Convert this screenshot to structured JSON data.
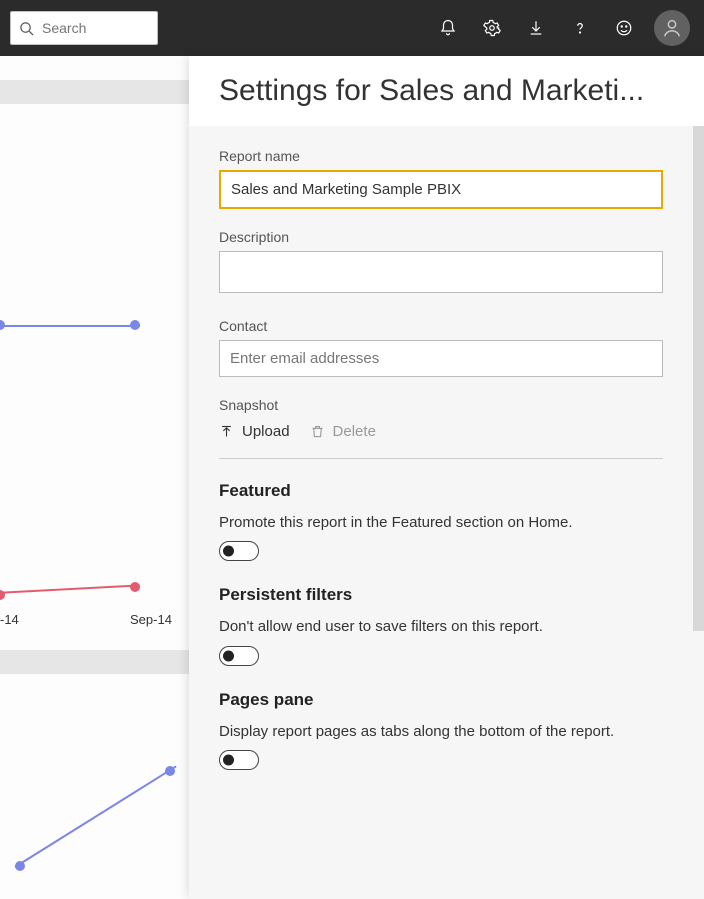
{
  "search": {
    "placeholder": "Search"
  },
  "panel": {
    "title": "Settings for Sales and Marketi...",
    "report_name_label": "Report name",
    "report_name_value": "Sales and Marketing Sample PBIX",
    "description_label": "Description",
    "description_value": "",
    "contact_label": "Contact",
    "contact_placeholder": "Enter email addresses",
    "snapshot_label": "Snapshot",
    "upload_label": "Upload",
    "delete_label": "Delete",
    "sections": {
      "featured": {
        "head": "Featured",
        "desc": "Promote this report in the Featured section on Home.",
        "toggle": false
      },
      "persistent": {
        "head": "Persistent filters",
        "desc": "Don't allow end user to save filters on this report.",
        "toggle": false
      },
      "pages": {
        "head": "Pages pane",
        "desc": "Display report pages as tabs along the bottom of the report.",
        "toggle": false
      }
    }
  },
  "background_axis": {
    "tick1": "-14",
    "tick2": "Sep-14"
  }
}
